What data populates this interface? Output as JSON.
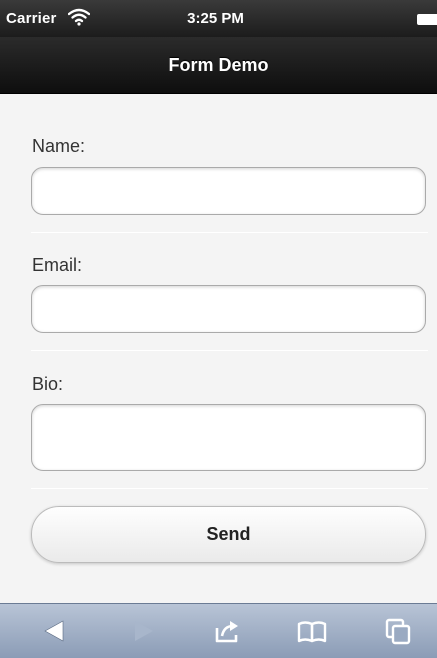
{
  "status_bar": {
    "carrier": "Carrier",
    "time": "3:25 PM"
  },
  "header": {
    "title": "Form Demo"
  },
  "form": {
    "name": {
      "label": "Name:",
      "value": ""
    },
    "email": {
      "label": "Email:",
      "value": ""
    },
    "bio": {
      "label": "Bio:",
      "value": ""
    },
    "send_label": "Send"
  },
  "toolbar": {
    "icons": [
      "back-icon",
      "forward-icon",
      "share-icon",
      "bookmarks-icon",
      "tabs-icon"
    ]
  },
  "colors": {
    "header": "#111111",
    "toolbar": "#9aaac2",
    "content_background": "#f4f4f4"
  }
}
